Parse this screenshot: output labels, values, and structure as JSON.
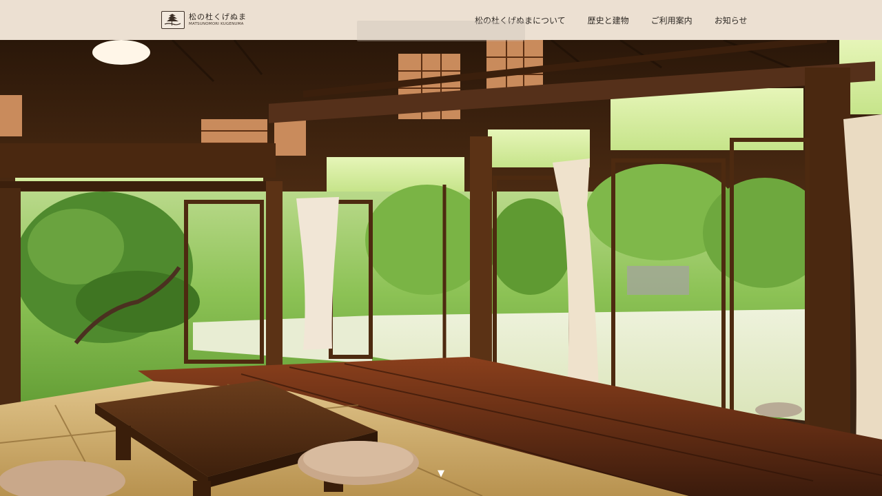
{
  "header": {
    "logo": {
      "title": "松の杜くげぬま",
      "subtitle": "MATSUNOMORI KUGENUMA"
    },
    "nav": [
      {
        "label": "松の杜くげぬまについて"
      },
      {
        "label": "歴史と建物"
      },
      {
        "label": "ご利用案内"
      },
      {
        "label": "お知らせ"
      }
    ]
  },
  "hero": {
    "scroll_indicator": "▼"
  },
  "colors": {
    "header_bg": "#ece0d2",
    "wood_dark": "#3a2414",
    "wood_mid": "#6b3c1c",
    "foliage": "#7fb84a",
    "tatami": "#d8b878"
  }
}
